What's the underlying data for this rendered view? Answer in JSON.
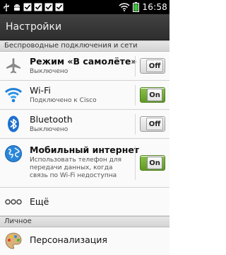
{
  "status_bar": {
    "clock": "16:58",
    "icons": [
      "usb-icon",
      "android-debug-icon",
      "check-notification-icon",
      "check-notification-icon",
      "check-notification-icon",
      "check-notification-icon",
      "wifi-signal-icon",
      "battery-icon"
    ]
  },
  "title_bar": {
    "title": "Настройки"
  },
  "sections": {
    "wireless": "Беспроводные подключения и сети",
    "personal": "Личное"
  },
  "rows": {
    "airplane": {
      "label": "Режим «В самолёте»",
      "sub": "Выключено",
      "toggle": "Off",
      "icon": "airplane-icon"
    },
    "wifi": {
      "label": "Wi-Fi",
      "sub": "Подключено к Cisco",
      "toggle": "On",
      "icon": "wifi-icon"
    },
    "bluetooth": {
      "label": "Bluetooth",
      "sub": "Выключено",
      "toggle": "Off",
      "icon": "bluetooth-icon"
    },
    "mobile": {
      "label": "Мобильный интернет",
      "sub": "Использовать телефон для передачи данных, когда связь по Wi-Fi недоступна",
      "toggle": "On",
      "icon": "globe-icon"
    },
    "more": {
      "label": "Ещё",
      "icon": "more-dots-icon"
    },
    "personalization": {
      "label": "Персонализация",
      "icon": "palette-icon"
    }
  },
  "colors": {
    "toggle_on": "#6aa82c",
    "title_bar": "#3a3a3a",
    "status_bar": "#000000"
  }
}
